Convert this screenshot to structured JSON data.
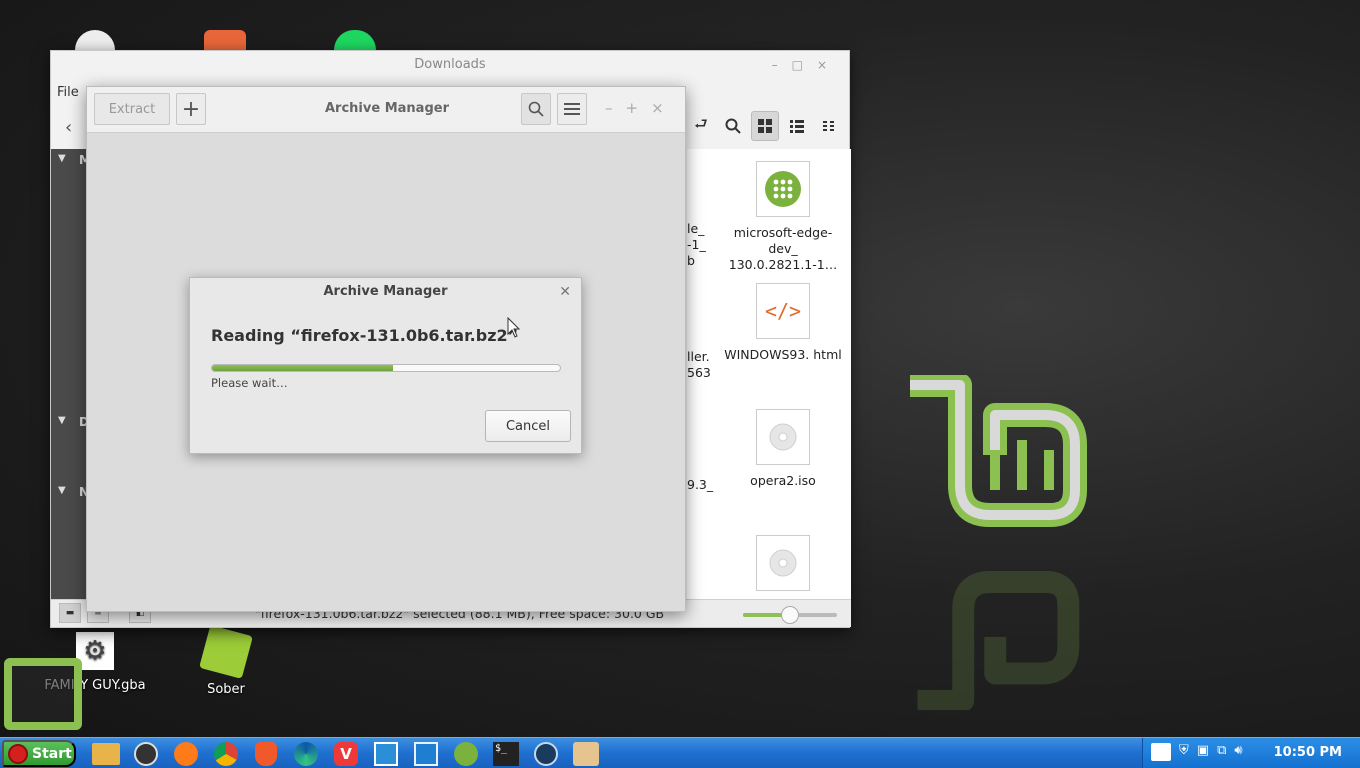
{
  "desktop": {
    "icons": [
      {
        "label": "FAMILY GUY.gba"
      },
      {
        "label": "Sober"
      }
    ]
  },
  "file_manager": {
    "title": "Downloads",
    "menu": {
      "file": "File"
    },
    "window_buttons": [
      "–",
      "□",
      "×"
    ],
    "sidebar_letters": [
      "M",
      "D",
      "N"
    ],
    "partial_texts": [
      "le_",
      "-1_",
      "b",
      "ller.",
      "563",
      "9.3_"
    ],
    "files": [
      {
        "name": "microsoft-edge-dev_ 130.0.2821.1-1…",
        "icon": "package-icon"
      },
      {
        "name": "WINDOWS93. html",
        "icon": "html-icon"
      },
      {
        "name": "opera2.iso",
        "icon": "disc-icon"
      },
      {
        "name": "",
        "icon": "disc-icon"
      }
    ],
    "status": "\"firefox-131.0b6.tar.bz2\" selected (88.1 MB), Free space: 30.0 GB",
    "zoom_level": 0.5
  },
  "archive_manager": {
    "title": "Archive Manager",
    "extract_label": "Extract",
    "add_label": "+"
  },
  "dialog": {
    "title": "Archive Manager",
    "message": "Reading “firefox-131.0b6.tar.bz2”",
    "progress": 0.52,
    "wait_text": "Please wait…",
    "cancel_label": "Cancel"
  },
  "taskbar": {
    "start_label": "Start",
    "clock": "10:50 PM",
    "apps": [
      "files",
      "obs",
      "firefox",
      "chrome",
      "brave",
      "edge-dev",
      "vivaldi",
      "remote",
      "monitor",
      "sober",
      "terminal",
      "steam",
      "archive"
    ]
  },
  "colors": {
    "accent": "#8fbf57",
    "taskbar": "#1f6fd0"
  }
}
